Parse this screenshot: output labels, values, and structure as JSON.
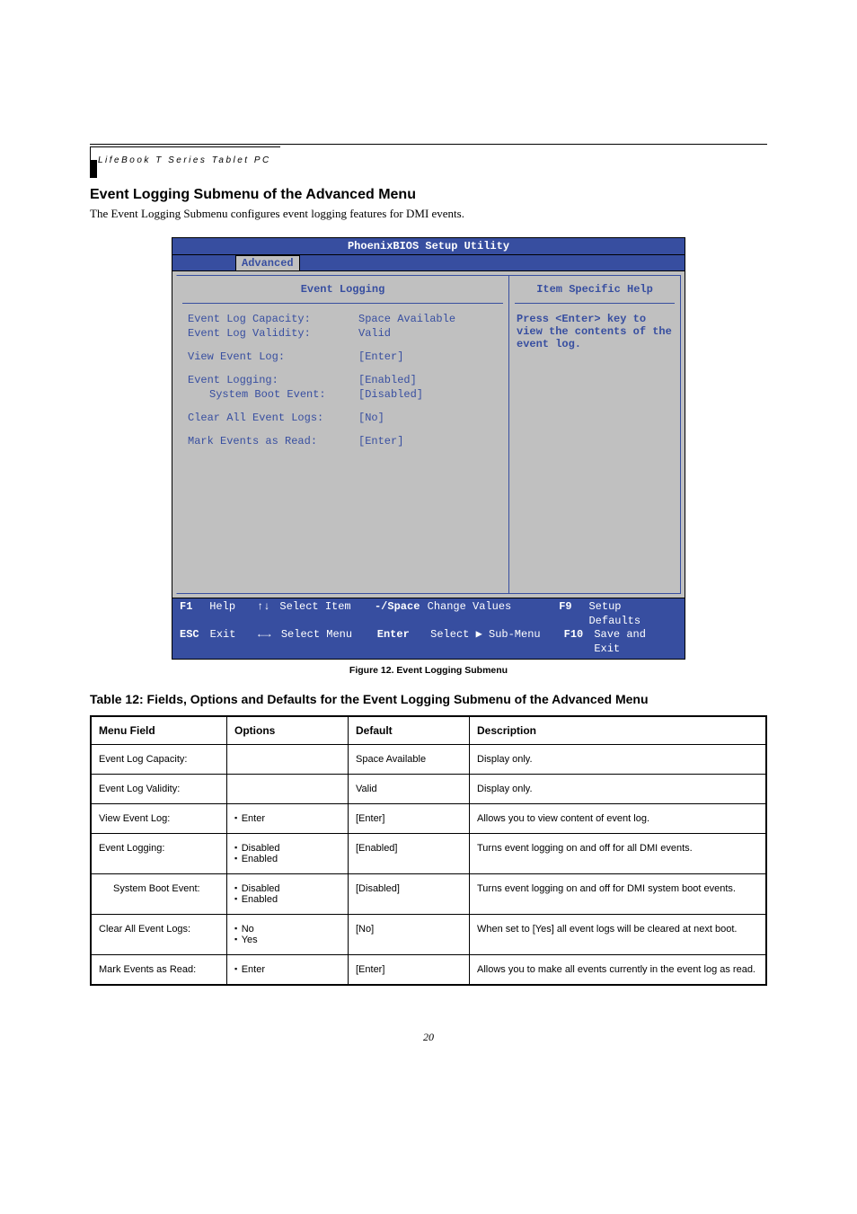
{
  "header": {
    "product_line": "LifeBook T Series Tablet PC"
  },
  "section": {
    "title": "Event Logging Submenu of the Advanced Menu",
    "intro": "The Event Logging Submenu configures event logging features for DMI events."
  },
  "bios": {
    "app_title": "PhoenixBIOS Setup Utility",
    "active_tab": "Advanced",
    "panel_title": "Event Logging",
    "help_panel_title": "Item Specific Help",
    "help_text": "Press <Enter> key to view the contents of the event log.",
    "fields": {
      "capacity_label": "Event Log Capacity:",
      "capacity_value": "Space Available",
      "validity_label": "Event Log Validity:",
      "validity_value": "Valid",
      "view_label": "View Event Log:",
      "view_value": "[Enter]",
      "logging_label": "Event Logging:",
      "logging_value": "[Enabled]",
      "sysboot_label": "System Boot Event:",
      "sysboot_value": "[Disabled]",
      "clear_label": "Clear All Event Logs:",
      "clear_value": "[No]",
      "mark_label": "Mark Events as Read:",
      "mark_value": "[Enter]"
    },
    "footer": {
      "f1": "F1",
      "help": "Help",
      "updown": "↑↓",
      "select_item": "Select Item",
      "minus_space": "-/Space",
      "change_values": "Change Values",
      "f9": "F9",
      "setup_defaults": "Setup Defaults",
      "esc": "ESC",
      "exit": "Exit",
      "leftright": "←→",
      "select_menu": "Select Menu",
      "enter": "Enter",
      "select_sub": "Select ▶ Sub-Menu",
      "f10": "F10",
      "save_exit": "Save and Exit"
    }
  },
  "figure_caption": "Figure 12.   Event Logging Submenu",
  "table": {
    "title": "Table 12: Fields, Options and Defaults for the Event Logging Submenu of the Advanced Menu",
    "headers": {
      "field": "Menu Field",
      "options": "Options",
      "default": "Default",
      "desc": "Description"
    },
    "rows": [
      {
        "field": "Event Log Capacity:",
        "options": [],
        "default": "Space Available",
        "desc": "Display only.",
        "indent": false
      },
      {
        "field": "Event Log Validity:",
        "options": [],
        "default": "Valid",
        "desc": "Display only.",
        "indent": false
      },
      {
        "field": "View Event Log:",
        "options": [
          "Enter"
        ],
        "default": "[Enter]",
        "desc": "Allows you to view content of event log.",
        "indent": false
      },
      {
        "field": "Event Logging:",
        "options": [
          "Disabled",
          "Enabled"
        ],
        "default": "[Enabled]",
        "desc": "Turns event logging on and off for all DMI events.",
        "indent": false
      },
      {
        "field": "System Boot Event:",
        "options": [
          "Disabled",
          "Enabled"
        ],
        "default": "[Disabled]",
        "desc": "Turns event logging on and off for DMI system boot events.",
        "indent": true
      },
      {
        "field": "Clear All Event Logs:",
        "options": [
          "No",
          "Yes"
        ],
        "default": "[No]",
        "desc": "When set to [Yes] all event logs will be cleared at next boot.",
        "indent": false
      },
      {
        "field": "Mark Events as Read:",
        "options": [
          "Enter"
        ],
        "default": "[Enter]",
        "desc": "Allows you to make all events currently in the event log as read.",
        "indent": false
      }
    ]
  },
  "page_number": "20"
}
